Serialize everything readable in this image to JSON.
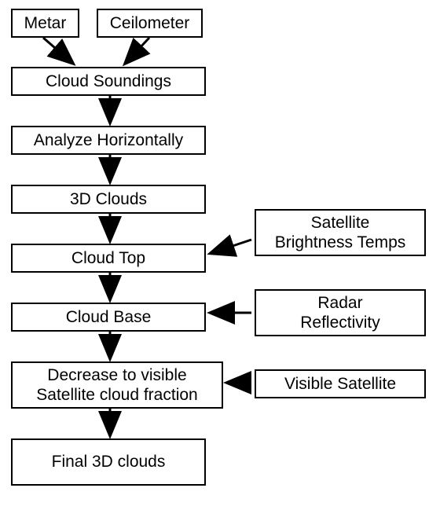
{
  "boxes": {
    "metar": "Metar",
    "ceilometer": "Ceilometer",
    "cloud_soundings": "Cloud Soundings",
    "analyze_horizontally": "Analyze Horizontally",
    "three_d_clouds": "3D Clouds",
    "cloud_top": "Cloud Top",
    "cloud_base": "Cloud Base",
    "decrease_visible": "Decrease to visible\nSatellite cloud fraction",
    "final_3d_clouds": "Final 3D clouds",
    "satellite_brightness": "Satellite\nBrightness Temps",
    "radar_reflectivity": "Radar\nReflectivity",
    "visible_satellite": "Visible Satellite"
  }
}
